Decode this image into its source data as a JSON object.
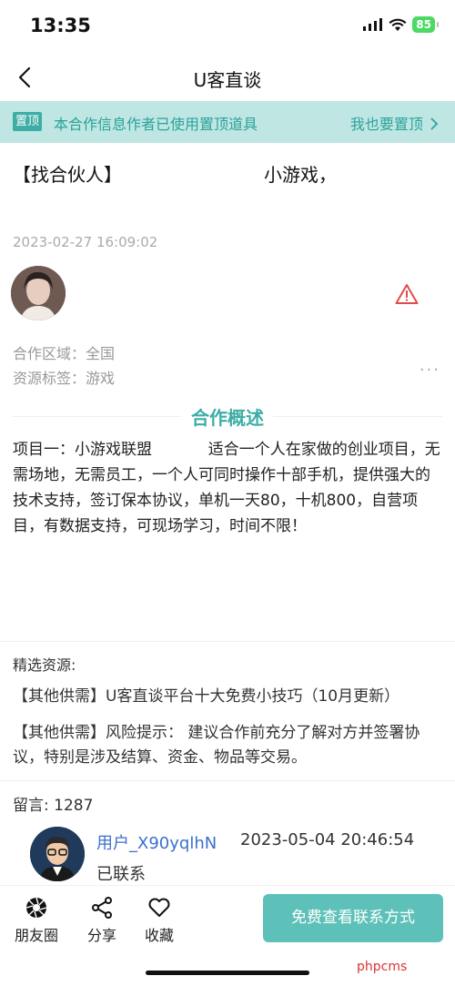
{
  "status": {
    "time": "13:35",
    "battery": "85"
  },
  "nav": {
    "title": "U客直谈"
  },
  "pin": {
    "tag": "置顶",
    "text": "本合作信息作者已使用置顶道具",
    "action": "我也要置顶"
  },
  "post": {
    "title_left": "【找合伙人】",
    "title_right": "小游戏，",
    "date": "2023-02-27 16:09:02",
    "region_label": "合作区域：",
    "region_value": "全国",
    "tag_label": "资源标签：",
    "tag_value": "游戏"
  },
  "overview": {
    "heading": "合作概述",
    "body": "项目一：小游戏联盟 　　　 适合一个人在家做的创业项目，无需场地，无需员工，一个人可同时操作十部手机，提供强大的技术支持，签订保本协议，单机一天80，十机800，自营项目，有数据支持，可现场学习，时间不限！"
  },
  "selected": {
    "label": "精选资源:",
    "item1": "【其他供需】U客直谈平台十大免费小技巧（10月更新）",
    "item2": "【其他供需】风险提示： 建议合作前充分了解对方并签署协议，特别是涉及结算、资金、物品等交易。"
  },
  "comments": {
    "label": "留言: 1287",
    "user": "用户_X90yqlhN",
    "time": "2023-05-04 20:46:54",
    "text": "已联系"
  },
  "bottom": {
    "moments": "朋友圈",
    "share": "分享",
    "favorite": "收藏",
    "cta": "免费查看联系方式"
  },
  "watermark": "phpcms",
  "colors": {
    "accent": "#3dada6",
    "pin_bg": "#bfe6e3",
    "cta": "#5ec1b9",
    "link": "#3b6fcf"
  }
}
